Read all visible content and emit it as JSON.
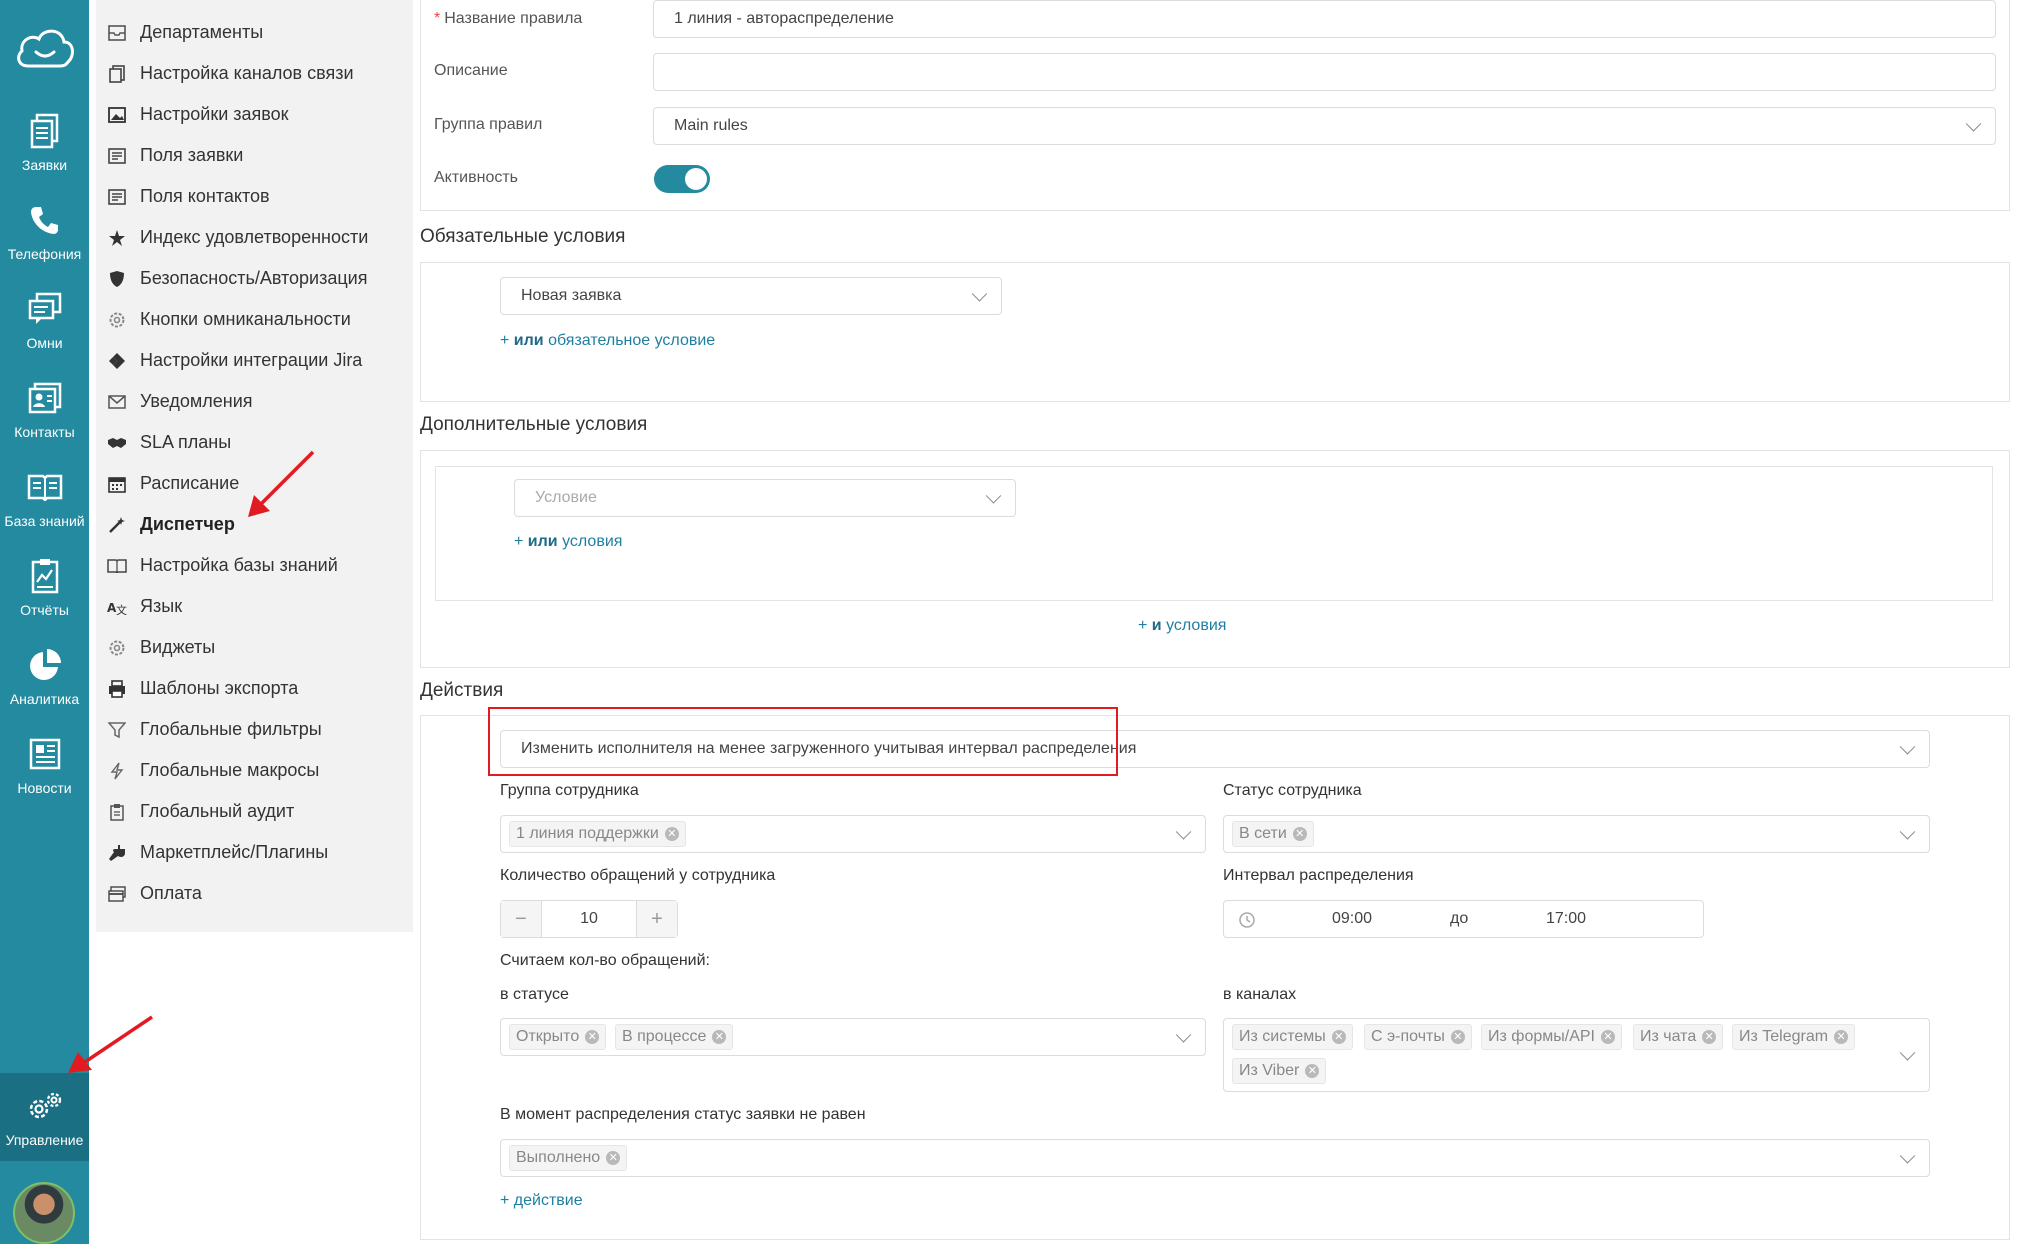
{
  "rail": {
    "items": [
      {
        "label": "Заявки",
        "icon": "tickets-icon"
      },
      {
        "label": "Телефония",
        "icon": "phone-icon"
      },
      {
        "label": "Омни",
        "icon": "omni-chat-icon"
      },
      {
        "label": "Контакты",
        "icon": "contacts-icon"
      },
      {
        "label": "База знаний",
        "icon": "knowledge-base-icon"
      },
      {
        "label": "Отчёты",
        "icon": "reports-icon"
      },
      {
        "label": "Аналитика",
        "icon": "analytics-pie-icon"
      },
      {
        "label": "Новости",
        "icon": "news-icon"
      },
      {
        "label": "Управление",
        "icon": "gears-icon"
      }
    ]
  },
  "menu": {
    "items": [
      {
        "label": "Департаменты"
      },
      {
        "label": "Настройка каналов связи"
      },
      {
        "label": "Настройки заявок"
      },
      {
        "label": "Поля заявки"
      },
      {
        "label": "Поля контактов"
      },
      {
        "label": "Индекс удовлетворенности"
      },
      {
        "label": "Безопасность/Авторизация"
      },
      {
        "label": "Кнопки омниканальности"
      },
      {
        "label": "Настройки интеграции Jira"
      },
      {
        "label": "Уведомления"
      },
      {
        "label": "SLA планы"
      },
      {
        "label": "Расписание"
      },
      {
        "label": "Диспетчер"
      },
      {
        "label": "Настройка базы знаний"
      },
      {
        "label": "Язык"
      },
      {
        "label": "Виджеты"
      },
      {
        "label": "Шаблоны экспорта"
      },
      {
        "label": "Глобальные фильтры"
      },
      {
        "label": "Глобальные макросы"
      },
      {
        "label": "Глобальный аудит"
      },
      {
        "label": "Маркетплейс/Плагины"
      },
      {
        "label": "Оплата"
      }
    ]
  },
  "form": {
    "rule_name_label": "Название правила",
    "rule_name_value": "1 линия - автораспределение",
    "description_label": "Описание",
    "description_value": "",
    "group_label": "Группа правил",
    "group_value": "Main rules",
    "active_label": "Активность",
    "active_on": true
  },
  "required_conditions": {
    "title": "Обязательные условия",
    "select_value": "Новая заявка",
    "add_or_prefix": "+ ",
    "add_or_bold": "или",
    "add_or_rest": " обязательное условие"
  },
  "additional_conditions": {
    "title": "Дополнительные условия",
    "select_placeholder": "Условие",
    "add_or_prefix": "+ ",
    "add_or_bold": "или",
    "add_or_rest": " условия",
    "add_and_prefix": "+ ",
    "add_and_bold": "и",
    "add_and_rest": " условия"
  },
  "actions": {
    "title": "Действия",
    "action_value": "Изменить исполнителя на менее загруженного учитывая интервал распределения",
    "employee_group_label": "Группа сотрудника",
    "employee_group_tags": [
      "1 линия поддержки"
    ],
    "employee_status_label": "Статус сотрудника",
    "employee_status_tags": [
      "В сети"
    ],
    "requests_count_label": "Количество обращений у сотрудника",
    "requests_count_value": "10",
    "minus": "−",
    "plus": "+",
    "interval_label": "Интервал распределения",
    "interval_from": "09:00",
    "interval_to_word": "до",
    "interval_to": "17:00",
    "count_label": "Считаем кол-во обращений:",
    "in_status_label": "в статусе",
    "status_tags": [
      "Открыто",
      "В процессе"
    ],
    "in_channels_label": "в каналах",
    "channel_tags": [
      "Из системы",
      "С э-почты",
      "Из формы/API",
      "Из чата",
      "Из Telegram",
      "Из Viber"
    ],
    "not_equal_label": "В момент распределения статус заявки не равен",
    "not_equal_tags": [
      "Выполнено"
    ],
    "add_action": "+ действие"
  },
  "colors": {
    "rail_bg": "#238aa0",
    "accent": "#1f7fa0",
    "highlight_red": "#e11b22"
  }
}
